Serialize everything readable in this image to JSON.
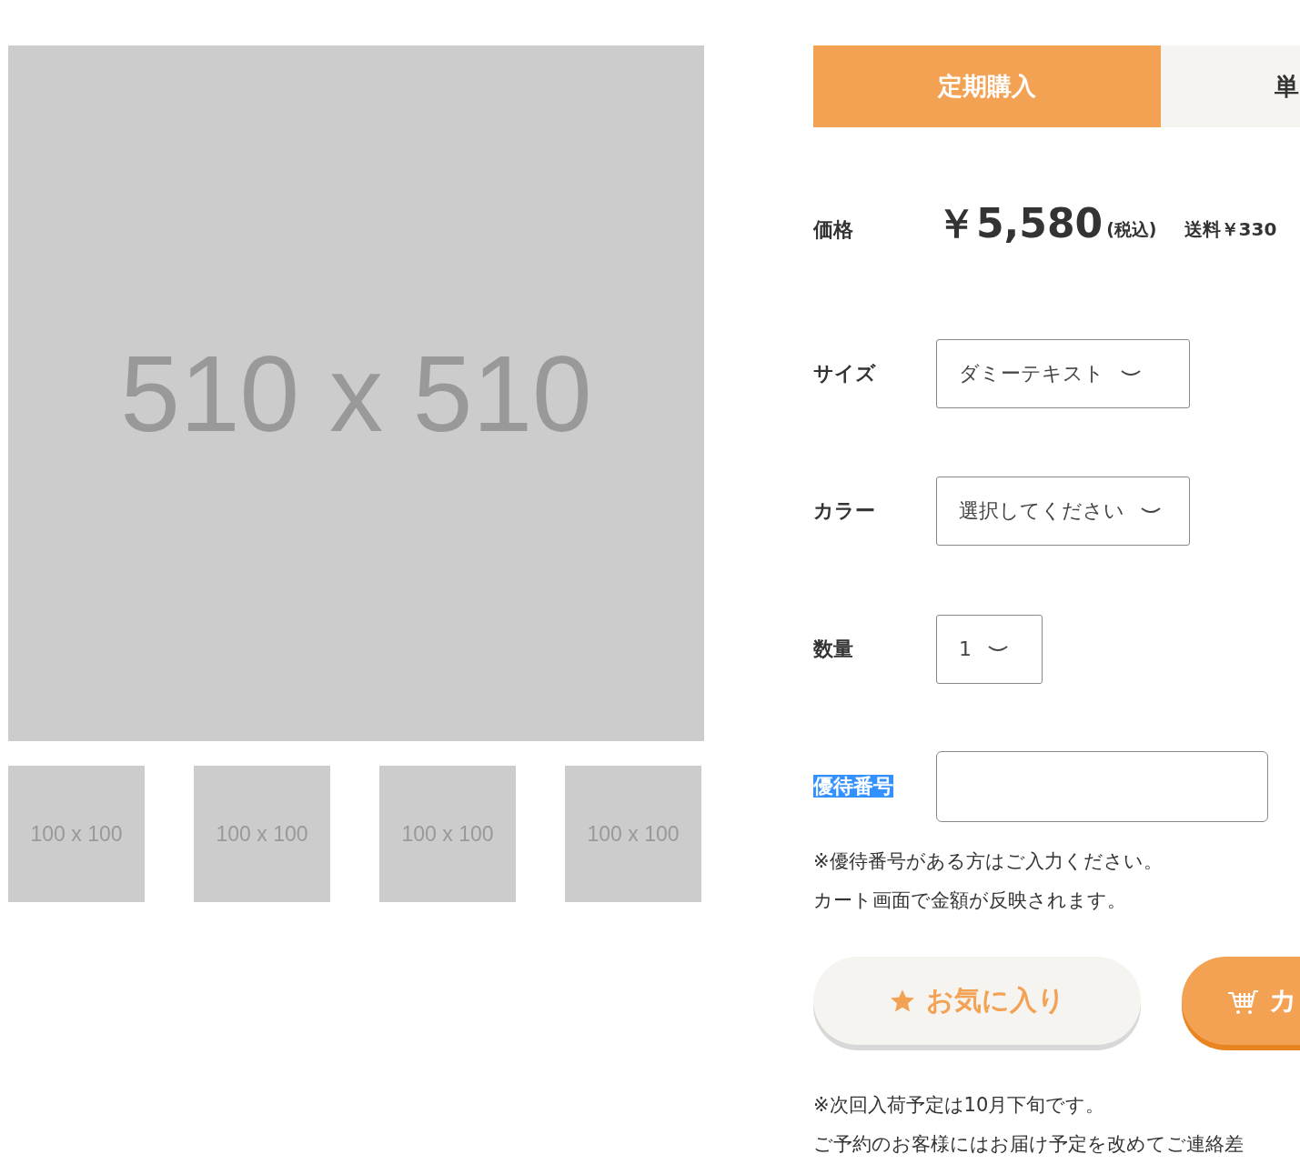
{
  "main_image": {
    "caption": "510 x 510"
  },
  "thumbnails": [
    {
      "caption": "100 x 100"
    },
    {
      "caption": "100 x 100"
    },
    {
      "caption": "100 x 100"
    },
    {
      "caption": "100 x 100"
    }
  ],
  "tabs": [
    {
      "label": "定期購入",
      "selected": true
    },
    {
      "label": "単",
      "selected": false
    }
  ],
  "price": {
    "label": "価格",
    "amount": "￥5,580",
    "tax": "(税込)",
    "shipping": "送料￥330"
  },
  "options": [
    {
      "label": "サイズ",
      "kind": "select",
      "value": "ダミーテキスト",
      "highlighted": false
    },
    {
      "label": "カラー",
      "kind": "select",
      "value": "選択してください",
      "highlighted": false
    },
    {
      "label": "数量",
      "kind": "select",
      "value": "1",
      "highlighted": false
    },
    {
      "label": "優待番号",
      "kind": "input",
      "highlighted": true
    }
  ],
  "coupon_notes": [
    "※優待番号がある方はご入力ください。",
    "カート画面で金額が反映されます。"
  ],
  "buttons": [
    {
      "kind": "favorite",
      "label": "お気に入り"
    },
    {
      "kind": "cart",
      "label": "カ"
    }
  ],
  "stock_notes": [
    "※次回入荷予定は10月下旬です。",
    "ご予約のお客様にはお届け予定を改めてご連絡差"
  ]
}
